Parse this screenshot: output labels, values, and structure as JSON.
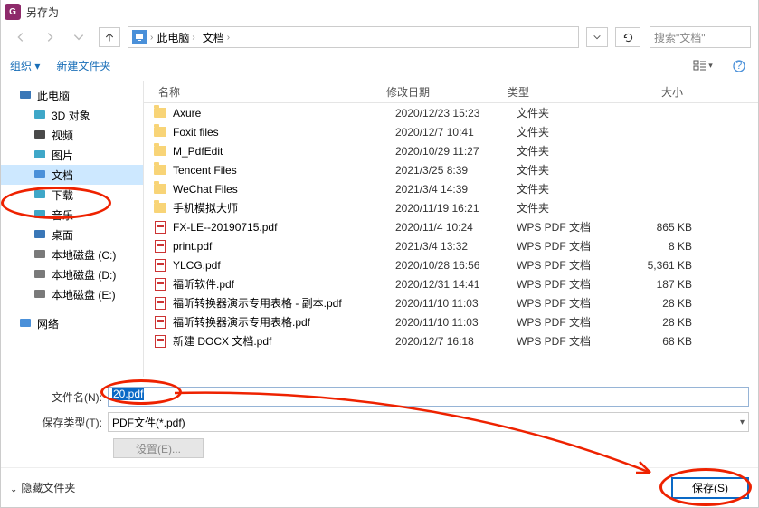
{
  "title": "另存为",
  "app_icon_letter": "G",
  "path": {
    "segs": [
      "此电脑",
      "文档"
    ]
  },
  "search_placeholder": "搜索\"文档\"",
  "toolbar": {
    "organize": "组织",
    "new_folder": "新建文件夹"
  },
  "columns": {
    "name": "名称",
    "date": "修改日期",
    "type": "类型",
    "size": "大小"
  },
  "sidebar": [
    {
      "label": "此电脑",
      "kind": "pc",
      "child": false
    },
    {
      "label": "3D 对象",
      "kind": "3d",
      "child": true
    },
    {
      "label": "视频",
      "kind": "video",
      "child": true
    },
    {
      "label": "图片",
      "kind": "image",
      "child": true
    },
    {
      "label": "文档",
      "kind": "doc",
      "child": true,
      "selected": true
    },
    {
      "label": "下载",
      "kind": "download",
      "child": true
    },
    {
      "label": "音乐",
      "kind": "music",
      "child": true
    },
    {
      "label": "桌面",
      "kind": "desktop",
      "child": true
    },
    {
      "label": "本地磁盘 (C:)",
      "kind": "disk",
      "child": true
    },
    {
      "label": "本地磁盘 (D:)",
      "kind": "disk",
      "child": true
    },
    {
      "label": "本地磁盘 (E:)",
      "kind": "disk",
      "child": true
    },
    {
      "label": "",
      "kind": "spacer",
      "child": false
    },
    {
      "label": "网络",
      "kind": "net",
      "child": false
    }
  ],
  "files": [
    {
      "name": "Axure",
      "date": "2020/12/23 15:23",
      "type": "文件夹",
      "size": "",
      "icon": "folder"
    },
    {
      "name": "Foxit files",
      "date": "2020/12/7 10:41",
      "type": "文件夹",
      "size": "",
      "icon": "folder"
    },
    {
      "name": "M_PdfEdit",
      "date": "2020/10/29 11:27",
      "type": "文件夹",
      "size": "",
      "icon": "folder"
    },
    {
      "name": "Tencent Files",
      "date": "2021/3/25 8:39",
      "type": "文件夹",
      "size": "",
      "icon": "folder"
    },
    {
      "name": "WeChat Files",
      "date": "2021/3/4 14:39",
      "type": "文件夹",
      "size": "",
      "icon": "folder"
    },
    {
      "name": "手机模拟大师",
      "date": "2020/11/19 16:21",
      "type": "文件夹",
      "size": "",
      "icon": "folder"
    },
    {
      "name": "FX-LE--20190715.pdf",
      "date": "2020/11/4 10:24",
      "type": "WPS PDF 文档",
      "size": "865 KB",
      "icon": "pdf"
    },
    {
      "name": "print.pdf",
      "date": "2021/3/4 13:32",
      "type": "WPS PDF 文档",
      "size": "8 KB",
      "icon": "pdf"
    },
    {
      "name": "YLCG.pdf",
      "date": "2020/10/28 16:56",
      "type": "WPS PDF 文档",
      "size": "5,361 KB",
      "icon": "pdf"
    },
    {
      "name": "福昕软件.pdf",
      "date": "2020/12/31 14:41",
      "type": "WPS PDF 文档",
      "size": "187 KB",
      "icon": "pdf"
    },
    {
      "name": "福昕转换器演示专用表格 - 副本.pdf",
      "date": "2020/11/10 11:03",
      "type": "WPS PDF 文档",
      "size": "28 KB",
      "icon": "pdf"
    },
    {
      "name": "福昕转换器演示专用表格.pdf",
      "date": "2020/11/10 11:03",
      "type": "WPS PDF 文档",
      "size": "28 KB",
      "icon": "pdf"
    },
    {
      "name": "新建 DOCX 文档.pdf",
      "date": "2020/12/7 16:18",
      "type": "WPS PDF 文档",
      "size": "68 KB",
      "icon": "pdf"
    }
  ],
  "fields": {
    "filename_label": "文件名(N):",
    "filename_value": "20.pdf",
    "filetype_label": "保存类型(T):",
    "filetype_value": "PDF文件(*.pdf)",
    "settings_label": "设置(E)..."
  },
  "footer": {
    "hide": "隐藏文件夹",
    "save": "保存(S)"
  },
  "side_colors": {
    "pc": "#3a77b7",
    "3d": "#3fa7c8",
    "video": "#4a4a4a",
    "image": "#3fa7c8",
    "doc": "#4a90d9",
    "download": "#3fa7c8",
    "music": "#3fa7c8",
    "desktop": "#3a77b7",
    "disk": "#7a7a7a",
    "net": "#4a90d9",
    "spacer": "transparent"
  }
}
